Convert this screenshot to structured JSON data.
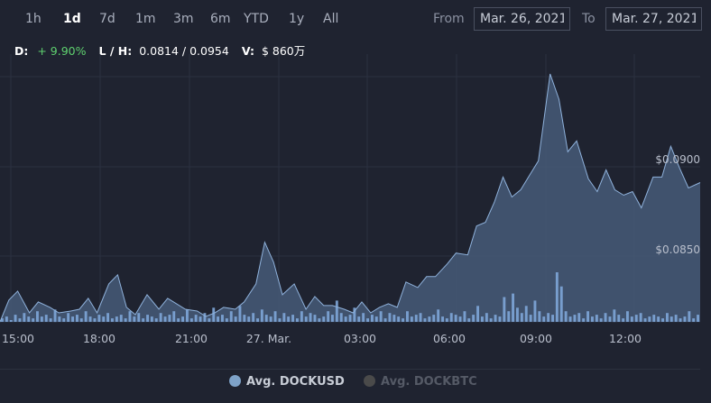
{
  "range_buttons": [
    {
      "label": "1h",
      "active": false
    },
    {
      "label": "1d",
      "active": true
    },
    {
      "label": "7d",
      "active": false
    },
    {
      "label": "1m",
      "active": false
    },
    {
      "label": "3m",
      "active": false
    },
    {
      "label": "6m",
      "active": false
    },
    {
      "label": "YTD",
      "active": false
    },
    {
      "label": "1y",
      "active": false
    },
    {
      "label": "All",
      "active": false
    }
  ],
  "date_range": {
    "from_label": "From",
    "from_value": "Mar. 26, 2021",
    "to_label": "To",
    "to_value": "Mar. 27, 2021"
  },
  "stats": {
    "d_key": "D:",
    "d_value": "+ 9.90%",
    "lh_key": "L / H:",
    "lh_value": "0.0814 / 0.0954",
    "v_key": "V:",
    "v_value": "$ 860万"
  },
  "colors": {
    "background": "#1f2330",
    "area_fill": "#475a78",
    "area_line": "#8fb2dc",
    "volume_bars": "#7ea6d8",
    "gridline": "#2b3040"
  },
  "chart_data": {
    "type": "area",
    "series": [
      {
        "name": "Avg. DOCKUSD",
        "hour_offsets": [
          0,
          0.3,
          0.6,
          1.0,
          1.3,
          1.7,
          2.0,
          2.4,
          2.7,
          3.0,
          3.3,
          3.7,
          4.0,
          4.3,
          4.6,
          5.0,
          5.4,
          5.7,
          6.0,
          6.3,
          6.7,
          7.0,
          7.3,
          7.6,
          8.0,
          8.3,
          8.7,
          9.0,
          9.3,
          9.6,
          10.0,
          10.4,
          10.7,
          11.0,
          11.3,
          11.7,
          12.0,
          12.3,
          12.6,
          12.9,
          13.2,
          13.5,
          13.8,
          14.2,
          14.5,
          14.8,
          15.2,
          15.5,
          15.9,
          16.2,
          16.5,
          16.8,
          17.1,
          17.4,
          17.7,
          18.0,
          18.3,
          18.7,
          19.0,
          19.3,
          19.6,
          20.0,
          20.3,
          20.6,
          20.9,
          21.2,
          21.5,
          21.8,
          22.2,
          22.5,
          22.8,
          23.1,
          23.4,
          23.8
        ],
        "values": [
          0.0815,
          0.0827,
          0.0832,
          0.082,
          0.0826,
          0.0823,
          0.082,
          0.0821,
          0.0822,
          0.0828,
          0.082,
          0.0836,
          0.0841,
          0.0823,
          0.0819,
          0.083,
          0.0822,
          0.0828,
          0.0825,
          0.0822,
          0.0821,
          0.0818,
          0.082,
          0.0823,
          0.0822,
          0.0826,
          0.0836,
          0.0859,
          0.0848,
          0.083,
          0.0836,
          0.0822,
          0.0829,
          0.0824,
          0.0824,
          0.0822,
          0.082,
          0.0826,
          0.082,
          0.0823,
          0.0825,
          0.0823,
          0.0837,
          0.0834,
          0.084,
          0.084,
          0.0847,
          0.0853,
          0.0852,
          0.0868,
          0.087,
          0.0881,
          0.0895,
          0.0884,
          0.0888,
          0.0896,
          0.0904,
          0.0952,
          0.0938,
          0.0909,
          0.0915,
          0.0894,
          0.0887,
          0.0899,
          0.0888,
          0.0885,
          0.0887,
          0.0878,
          0.0895,
          0.0895,
          0.0912,
          0.09,
          0.0889,
          0.0892
        ]
      },
      {
        "name": "Avg. DOCKBTC",
        "values": []
      }
    ],
    "volume": [
      2,
      3,
      1,
      4,
      2,
      5,
      3,
      2,
      6,
      3,
      4,
      2,
      7,
      3,
      2,
      5,
      3,
      4,
      2,
      6,
      3,
      2,
      4,
      3,
      5,
      2,
      3,
      4,
      2,
      6,
      3,
      5,
      2,
      4,
      3,
      2,
      5,
      3,
      4,
      6,
      2,
      3,
      7,
      2,
      4,
      3,
      5,
      2,
      8,
      3,
      4,
      2,
      6,
      3,
      9,
      4,
      3,
      5,
      2,
      7,
      4,
      3,
      6,
      2,
      5,
      3,
      4,
      2,
      6,
      3,
      5,
      4,
      2,
      3,
      6,
      4,
      12,
      5,
      3,
      4,
      8,
      3,
      5,
      2,
      4,
      3,
      6,
      2,
      5,
      4,
      3,
      2,
      6,
      3,
      4,
      5,
      2,
      3,
      4,
      7,
      3,
      2,
      5,
      4,
      3,
      6,
      2,
      4,
      9,
      3,
      5,
      2,
      4,
      3,
      14,
      6,
      16,
      8,
      5,
      9,
      4,
      12,
      6,
      3,
      5,
      4,
      28,
      20,
      6,
      3,
      4,
      5,
      2,
      6,
      3,
      4,
      2,
      5,
      3,
      7,
      4,
      2,
      6,
      3,
      4,
      5,
      2,
      3,
      4,
      3,
      2,
      5,
      3,
      4,
      2,
      3,
      6,
      2,
      4
    ],
    "x_tick_labels": [
      "15:00",
      "18:00",
      "21:00",
      "27. Mar.",
      "03:00",
      "06:00",
      "09:00",
      "12:00"
    ],
    "y_tick_labels": [
      "$0.0900",
      "$0.0850"
    ],
    "y_ticks": [
      0.09,
      0.085
    ],
    "ylim": [
      0.0815,
      0.0955
    ],
    "grid": true,
    "legend_position": "bottom-center",
    "xlabel": "",
    "ylabel": ""
  },
  "legend": {
    "items": [
      {
        "label": "Avg. DOCKUSD",
        "color": "#7ea2c8",
        "active": true
      },
      {
        "label": "Avg. DOCKBTC",
        "color": "#4a4a4a",
        "active": false
      }
    ]
  }
}
